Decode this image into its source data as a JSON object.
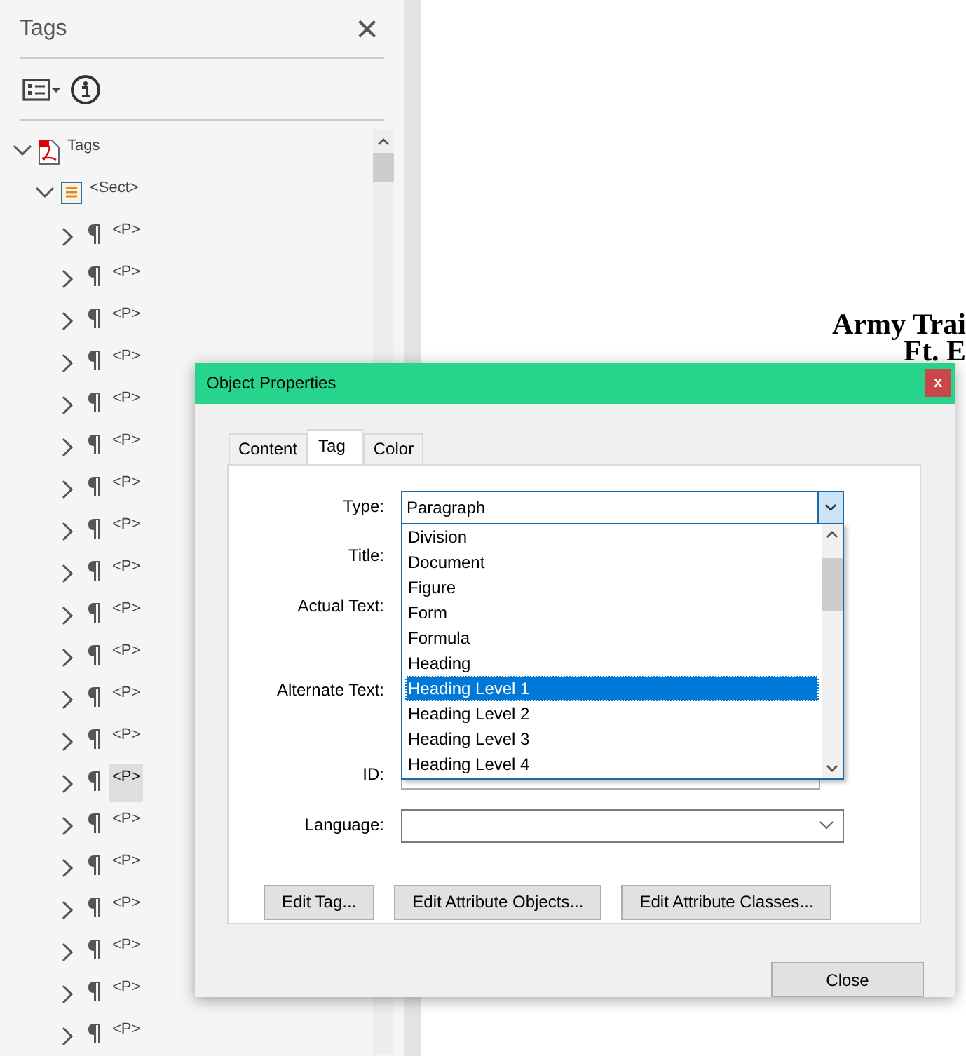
{
  "tags_panel": {
    "title": "Tags",
    "close": "×",
    "tree": [
      {
        "label": "Tags",
        "kind": "document",
        "expanded": true,
        "selected": false,
        "children": [
          {
            "label": "<Sect>",
            "kind": "section",
            "expanded": true,
            "selected": false,
            "children": [
              {
                "label": "<P>",
                "kind": "paragraph",
                "expanded": false,
                "selected": false
              },
              {
                "label": "<P>",
                "kind": "paragraph",
                "expanded": false,
                "selected": false
              },
              {
                "label": "<P>",
                "kind": "paragraph",
                "expanded": false,
                "selected": false
              },
              {
                "label": "<P>",
                "kind": "paragraph",
                "expanded": false,
                "selected": false
              },
              {
                "label": "<P>",
                "kind": "paragraph",
                "expanded": false,
                "selected": false
              },
              {
                "label": "<P>",
                "kind": "paragraph",
                "expanded": false,
                "selected": false
              },
              {
                "label": "<P>",
                "kind": "paragraph",
                "expanded": false,
                "selected": false
              },
              {
                "label": "<P>",
                "kind": "paragraph",
                "expanded": false,
                "selected": false
              },
              {
                "label": "<P>",
                "kind": "paragraph",
                "expanded": false,
                "selected": false
              },
              {
                "label": "<P>",
                "kind": "paragraph",
                "expanded": false,
                "selected": false
              },
              {
                "label": "<P>",
                "kind": "paragraph",
                "expanded": false,
                "selected": false
              },
              {
                "label": "<P>",
                "kind": "paragraph",
                "expanded": false,
                "selected": false
              },
              {
                "label": "<P>",
                "kind": "paragraph",
                "expanded": false,
                "selected": false
              },
              {
                "label": "<P>",
                "kind": "paragraph",
                "expanded": false,
                "selected": true
              },
              {
                "label": "<P>",
                "kind": "paragraph",
                "expanded": false,
                "selected": false
              },
              {
                "label": "<P>",
                "kind": "paragraph",
                "expanded": false,
                "selected": false
              },
              {
                "label": "<P>",
                "kind": "paragraph",
                "expanded": false,
                "selected": false
              },
              {
                "label": "<P>",
                "kind": "paragraph",
                "expanded": false,
                "selected": false
              },
              {
                "label": "<P>",
                "kind": "paragraph",
                "expanded": false,
                "selected": false
              },
              {
                "label": "<P>",
                "kind": "paragraph",
                "expanded": false,
                "selected": false
              }
            ]
          }
        ]
      }
    ]
  },
  "document": {
    "lines": [
      "Army Trai",
      "Ft. E"
    ]
  },
  "dialog": {
    "title": "Object Properties",
    "close": "x",
    "tabs": [
      {
        "label": "Content",
        "selected": false
      },
      {
        "label": "Tag",
        "selected": true
      },
      {
        "label": "Color",
        "selected": false
      }
    ],
    "type_field": {
      "label": "Type:",
      "value": "Paragraph",
      "open": true,
      "options": [
        {
          "label": "Division",
          "selected": false
        },
        {
          "label": "Document",
          "selected": false
        },
        {
          "label": "Figure",
          "selected": false
        },
        {
          "label": "Form",
          "selected": false
        },
        {
          "label": "Formula",
          "selected": false
        },
        {
          "label": "Heading",
          "selected": false
        },
        {
          "label": "Heading Level 1",
          "selected": true
        },
        {
          "label": "Heading Level 2",
          "selected": false
        },
        {
          "label": "Heading Level 3",
          "selected": false
        },
        {
          "label": "Heading Level 4",
          "selected": false
        }
      ]
    },
    "labels": [
      "Title:",
      "Actual Text:",
      "Alternate Text:",
      "ID:"
    ],
    "language_field": {
      "label": "Language:"
    },
    "buttons": [
      "Edit Tag...",
      "Edit Attribute Objects...",
      "Edit Attribute Classes..."
    ],
    "close_button": "Close"
  }
}
